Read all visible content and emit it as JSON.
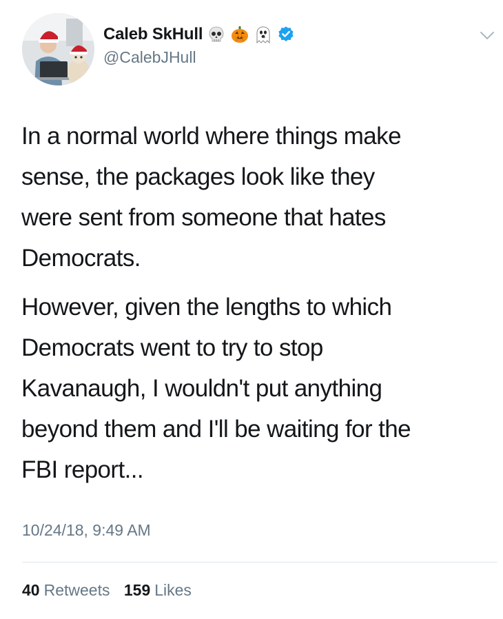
{
  "user": {
    "display_name": "Caleb SkHull",
    "handle": "@CalebJHull",
    "name_emojis": [
      "skull-emoji",
      "jack-o-lantern-emoji",
      "ghost-emoji"
    ],
    "verified": true
  },
  "tweet": {
    "paragraphs": [
      "In a normal world where things make\nsense, the packages look like they\nwere sent from someone that hates\nDemocrats.",
      "However, given the lengths to which\nDemocrats went to try to stop\nKavanaugh, I wouldn't put anything\nbeyond them and I'll be waiting for the\nFBI report..."
    ],
    "timestamp": "10/24/18, 9:49 AM"
  },
  "stats": {
    "retweets_count": "40",
    "retweets_label": "Retweets",
    "likes_count": "159",
    "likes_label": "Likes"
  },
  "colors": {
    "text": "#14171a",
    "muted": "#657786",
    "verified": "#1da1f2",
    "divider": "#e1e8ed"
  },
  "icons": {
    "menu": "chevron-down-icon",
    "verified": "verified-badge-icon"
  }
}
